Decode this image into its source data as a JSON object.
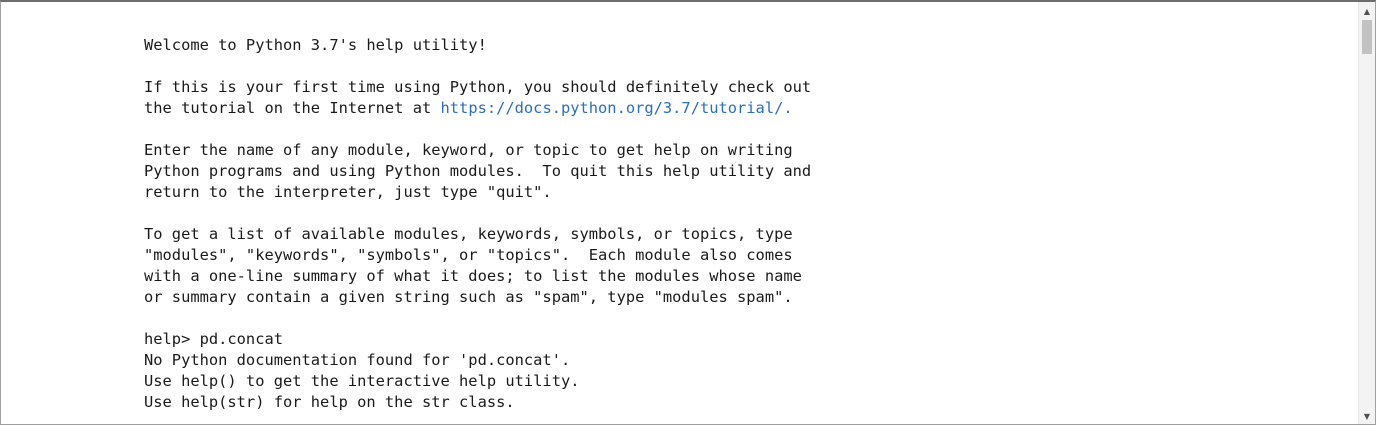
{
  "terminal": {
    "lines": [
      {
        "text": "Welcome to Python 3.7's help utility!"
      },
      {
        "text": ""
      },
      {
        "text": "If this is your first time using Python, you should definitely check out"
      },
      {
        "text": "the tutorial on the Internet at ",
        "link": "https://docs.python.org/3.7/tutorial/",
        "after": "."
      },
      {
        "text": ""
      },
      {
        "text": "Enter the name of any module, keyword, or topic to get help on writing"
      },
      {
        "text": "Python programs and using Python modules.  To quit this help utility and"
      },
      {
        "text": "return to the interpreter, just type \"quit\"."
      },
      {
        "text": ""
      },
      {
        "text": "To get a list of available modules, keywords, symbols, or topics, type"
      },
      {
        "text": "\"modules\", \"keywords\", \"symbols\", or \"topics\".  Each module also comes"
      },
      {
        "text": "with a one-line summary of what it does; to list the modules whose name"
      },
      {
        "text": "or summary contain a given string such as \"spam\", type \"modules spam\"."
      },
      {
        "text": ""
      },
      {
        "text": "help> pd.concat"
      },
      {
        "text": "No Python documentation found for 'pd.concat'."
      },
      {
        "text": "Use help() to get the interactive help utility."
      },
      {
        "text": "Use help(str) for help on the str class."
      }
    ]
  },
  "scrollbar": {
    "up_icon": "triangle-up-icon",
    "down_icon": "triangle-down-icon",
    "up_glyph": "▲",
    "down_glyph": "▼"
  },
  "colors": {
    "link": "#2c6fb7",
    "text": "#1a1a1a",
    "thumb": "#c2c2c2"
  }
}
